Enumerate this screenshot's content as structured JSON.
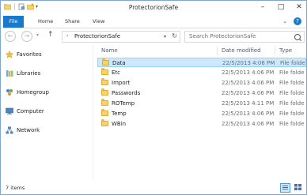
{
  "window": {
    "title": "ProtectorionSafe"
  },
  "quick_access": {
    "icons": [
      "folder-icon",
      "properties-icon",
      "new-folder-icon",
      "dropdown-icon"
    ]
  },
  "window_buttons": {
    "minimize": "–",
    "maximize": "□",
    "close": "✕"
  },
  "ribbon": {
    "tabs": [
      {
        "label": "File",
        "active": true
      },
      {
        "label": "Home"
      },
      {
        "label": "Share"
      },
      {
        "label": "View"
      }
    ],
    "help": "?"
  },
  "address": {
    "path": "ProtectorionSafe"
  },
  "search": {
    "placeholder": "Search ProtectorionSafe"
  },
  "nav": {
    "items": [
      {
        "label": "Favorites",
        "icon": "star-icon"
      },
      {
        "label": "Libraries",
        "icon": "libraries-icon"
      },
      {
        "label": "Homegroup",
        "icon": "homegroup-icon"
      },
      {
        "label": "Computer",
        "icon": "computer-icon"
      },
      {
        "label": "Network",
        "icon": "network-icon"
      }
    ]
  },
  "list": {
    "columns": [
      "Name",
      "Date modified",
      "Type"
    ],
    "rows": [
      {
        "name": "Data",
        "date": "22/5/2013 4:06 PM",
        "type": "File folde",
        "selected": true
      },
      {
        "name": "Etc",
        "date": "22/5/2013 4:06 PM",
        "type": "File folde"
      },
      {
        "name": "Import",
        "date": "22/5/2013 4:06 PM",
        "type": "File folde"
      },
      {
        "name": "Passwords",
        "date": "22/5/2013 4:06 PM",
        "type": "File folde"
      },
      {
        "name": "ROTemp",
        "date": "22/5/2013 4:11 PM",
        "type": "File folde"
      },
      {
        "name": "Temp",
        "date": "22/5/2013 4:06 PM",
        "type": "File folde"
      },
      {
        "name": "WBin",
        "date": "22/5/2013 4:06 PM",
        "type": "File folde"
      }
    ]
  },
  "status": {
    "text": "7 items"
  },
  "colors": {
    "accent": "#1979ca",
    "selection": "#cce8ff",
    "folder": "#f7d46b",
    "border": "#7fa7d6"
  }
}
